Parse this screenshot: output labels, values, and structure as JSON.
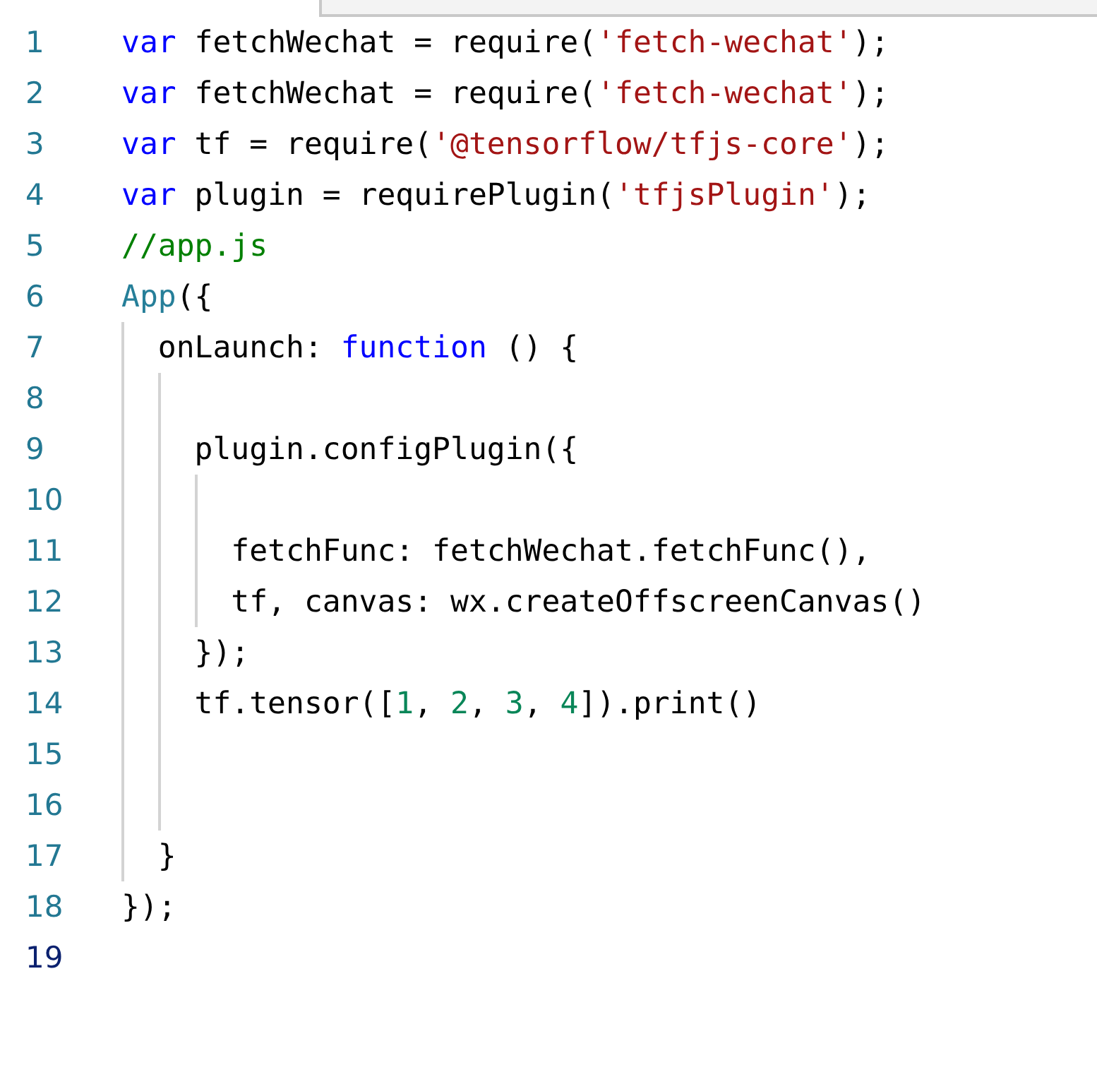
{
  "lines": [
    {
      "number": "1",
      "active": false,
      "tokens": [
        {
          "kind": "keyword",
          "text": "var"
        },
        {
          "kind": "plain",
          "text": " fetchWechat = require("
        },
        {
          "kind": "string",
          "text": "'fetch-wechat'"
        },
        {
          "kind": "plain",
          "text": ");"
        }
      ]
    },
    {
      "number": "2",
      "active": false,
      "tokens": [
        {
          "kind": "keyword",
          "text": "var"
        },
        {
          "kind": "plain",
          "text": " fetchWechat = require("
        },
        {
          "kind": "string",
          "text": "'fetch-wechat'"
        },
        {
          "kind": "plain",
          "text": ");"
        }
      ]
    },
    {
      "number": "3",
      "active": false,
      "tokens": [
        {
          "kind": "keyword",
          "text": "var"
        },
        {
          "kind": "plain",
          "text": " tf = require("
        },
        {
          "kind": "string",
          "text": "'@tensorflow/tfjs-core'"
        },
        {
          "kind": "plain",
          "text": ");"
        }
      ]
    },
    {
      "number": "4",
      "active": false,
      "tokens": [
        {
          "kind": "keyword",
          "text": "var"
        },
        {
          "kind": "plain",
          "text": " plugin = requirePlugin("
        },
        {
          "kind": "string",
          "text": "'tfjsPlugin'"
        },
        {
          "kind": "plain",
          "text": ");"
        }
      ]
    },
    {
      "number": "5",
      "active": false,
      "tokens": [
        {
          "kind": "comment",
          "text": "//app.js"
        }
      ]
    },
    {
      "number": "6",
      "active": false,
      "tokens": [
        {
          "kind": "type",
          "text": "App"
        },
        {
          "kind": "plain",
          "text": "({"
        }
      ]
    },
    {
      "number": "7",
      "active": false,
      "tokens": [
        {
          "kind": "plain",
          "text": "  onLaunch: "
        },
        {
          "kind": "keyword",
          "text": "function"
        },
        {
          "kind": "plain",
          "text": " () {"
        }
      ]
    },
    {
      "number": "8",
      "active": false
    },
    {
      "number": "9",
      "active": false,
      "tokens": [
        {
          "kind": "plain",
          "text": "    plugin.configPlugin({"
        }
      ]
    },
    {
      "number": "10",
      "active": false
    },
    {
      "number": "11",
      "active": false,
      "tokens": [
        {
          "kind": "plain",
          "text": "      fetchFunc: fetchWechat.fetchFunc(),"
        }
      ]
    },
    {
      "number": "12",
      "active": false,
      "tokens": [
        {
          "kind": "plain",
          "text": "      tf, canvas: wx.createOffscreenCanvas()"
        }
      ]
    },
    {
      "number": "13",
      "active": false,
      "tokens": [
        {
          "kind": "plain",
          "text": "    });"
        }
      ]
    },
    {
      "number": "14",
      "active": false,
      "tokens": [
        {
          "kind": "plain",
          "text": "    tf.tensor(["
        },
        {
          "kind": "number",
          "text": "1"
        },
        {
          "kind": "plain",
          "text": ", "
        },
        {
          "kind": "number",
          "text": "2"
        },
        {
          "kind": "plain",
          "text": ", "
        },
        {
          "kind": "number",
          "text": "3"
        },
        {
          "kind": "plain",
          "text": ", "
        },
        {
          "kind": "number",
          "text": "4"
        },
        {
          "kind": "plain",
          "text": "]).print()"
        }
      ]
    },
    {
      "number": "15",
      "active": false
    },
    {
      "number": "16",
      "active": false
    },
    {
      "number": "17",
      "active": false,
      "tokens": [
        {
          "kind": "plain",
          "text": "  }"
        }
      ]
    },
    {
      "number": "18",
      "active": false,
      "tokens": [
        {
          "kind": "plain",
          "text": "});"
        }
      ]
    },
    {
      "number": "19",
      "active": true
    }
  ]
}
